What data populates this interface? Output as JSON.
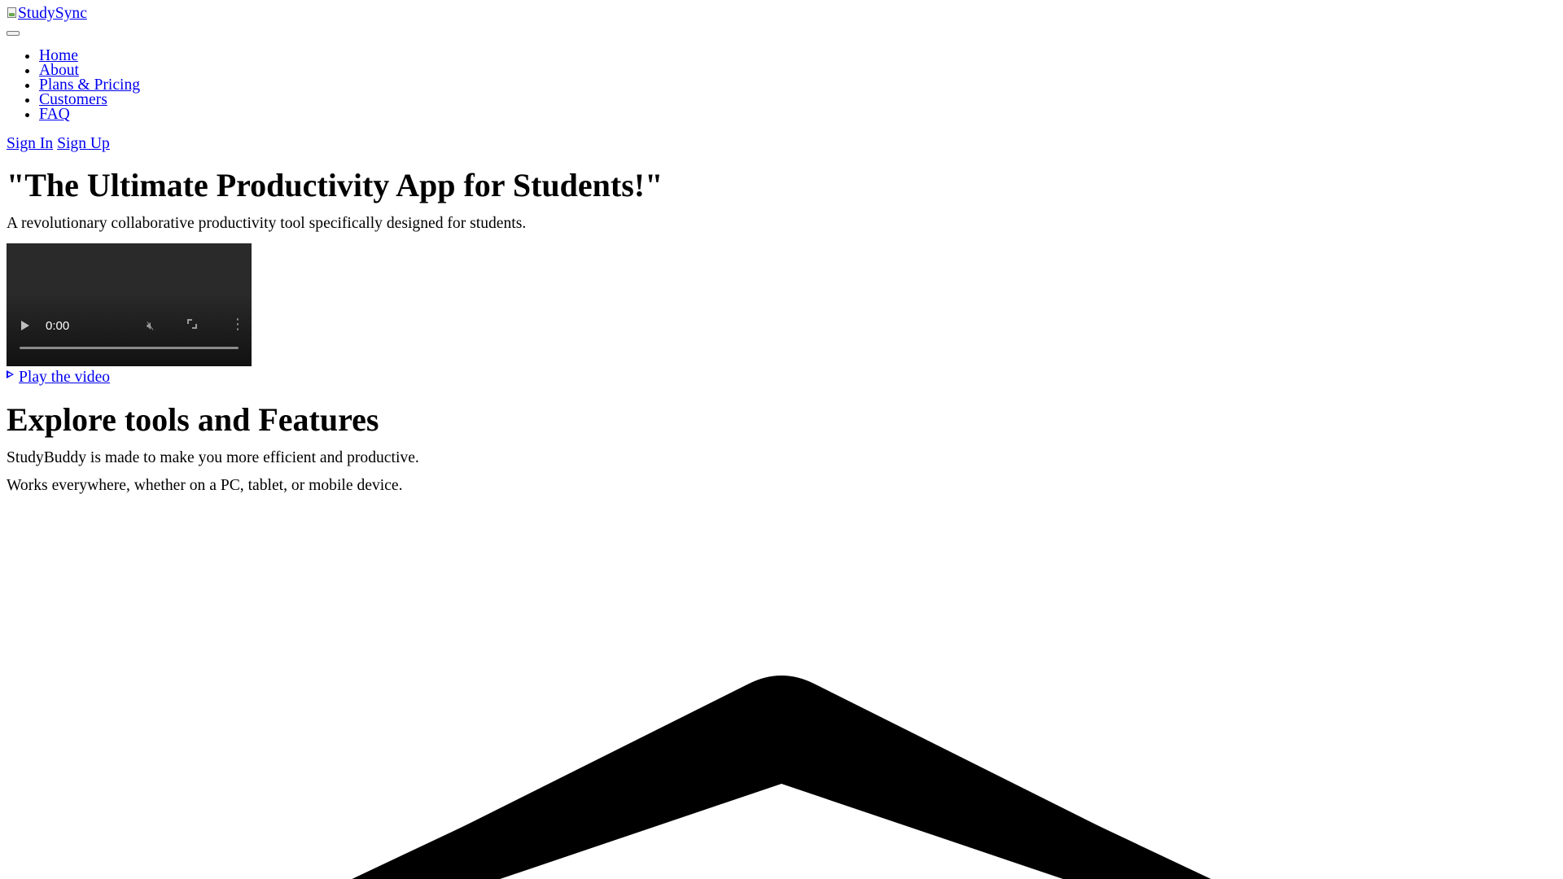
{
  "header": {
    "logo_alt": "StudySync",
    "nav": [
      "Home",
      "About",
      "Plans & Pricing",
      "Customers",
      "FAQ"
    ],
    "auth": {
      "sign_in": "Sign In",
      "sign_up": "Sign Up"
    }
  },
  "hero": {
    "title": "\"The Ultimate Productivity App for Students!\"",
    "description": "A revolutionary collaborative productivity tool specifically designed for students.",
    "video": {
      "time": "0:00",
      "play_icon": "play-icon",
      "mute_icon": "muted-icon",
      "fullscreen_icon": "fullscreen-icon",
      "more_icon": "more-vertical-icon"
    },
    "play_link": "Play the video"
  },
  "features": {
    "title": "Explore tools and Features",
    "line1": "StudyBuddy is made to make you more efficient and productive.",
    "line2": "Works everywhere, whether on a PC, tablet, or mobile device."
  },
  "decor": {
    "chevron_icon": "chevron-up-icon",
    "chevron_color": "#000000"
  }
}
